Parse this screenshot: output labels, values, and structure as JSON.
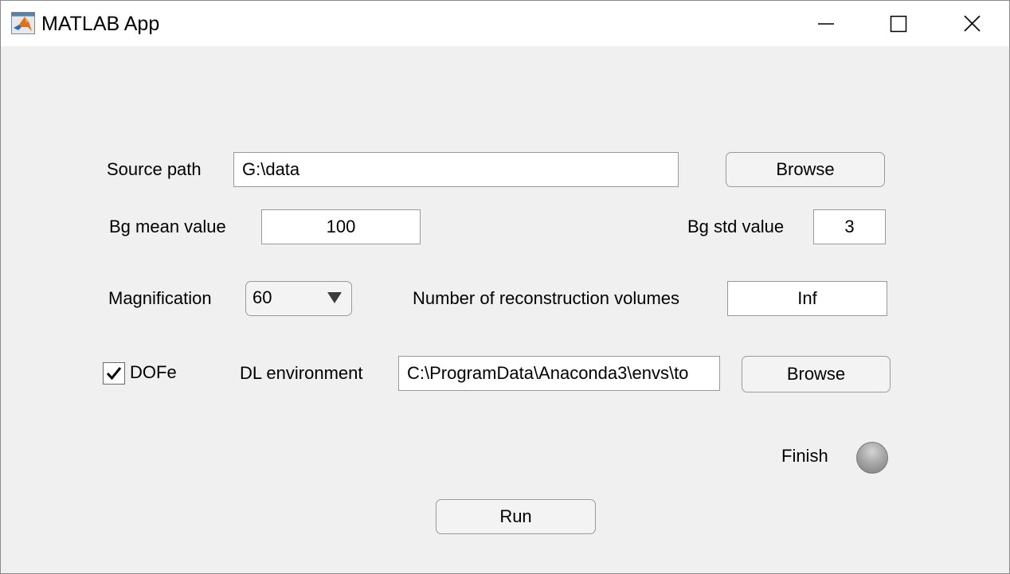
{
  "window": {
    "title": "MATLAB App",
    "app_icon": "matlab-logo-icon",
    "controls": [
      "minimize-icon",
      "maximize-icon",
      "close-icon"
    ]
  },
  "form": {
    "source_path": {
      "label": "Source path",
      "value": "G:\\data",
      "browse_label": "Browse"
    },
    "bg_mean": {
      "label": "Bg mean value",
      "value": "100"
    },
    "bg_std": {
      "label": "Bg std value",
      "value": "3"
    },
    "magnification": {
      "label": "Magnification",
      "selected": "60"
    },
    "num_volumes": {
      "label": "Number of reconstruction volumes",
      "value": "Inf"
    },
    "dofe": {
      "label": "DOFe",
      "checked": true
    },
    "dl_environment": {
      "label": "DL environment",
      "value": "C:\\ProgramData\\Anaconda3\\envs\\to",
      "browse_label": "Browse"
    },
    "finish": {
      "label": "Finish",
      "lamp_color": "#a8a8a8"
    },
    "run_label": "Run"
  }
}
